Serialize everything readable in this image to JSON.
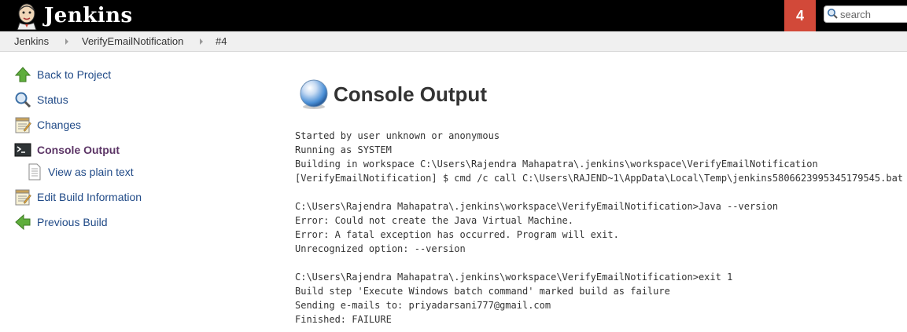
{
  "header": {
    "brand": "Jenkins",
    "notification_count": "4",
    "search_placeholder": "search"
  },
  "breadcrumbs": [
    "Jenkins",
    "VerifyEmailNotification",
    "#4"
  ],
  "sidebar": {
    "items": [
      {
        "label": "Back to Project",
        "icon": "up-arrow-icon"
      },
      {
        "label": "Status",
        "icon": "magnifier-icon"
      },
      {
        "label": "Changes",
        "icon": "notepad-icon"
      },
      {
        "label": "Console Output",
        "icon": "terminal-icon",
        "active": true
      },
      {
        "label": "View as plain text",
        "icon": "document-icon"
      },
      {
        "label": "Edit Build Information",
        "icon": "notepad-edit-icon"
      },
      {
        "label": "Previous Build",
        "icon": "left-arrow-icon"
      }
    ]
  },
  "main": {
    "title": "Console Output",
    "status_color": "#4a8fd6",
    "console_lines": [
      "Started by user unknown or anonymous",
      "Running as SYSTEM",
      "Building in workspace C:\\Users\\Rajendra Mahapatra\\.jenkins\\workspace\\VerifyEmailNotification",
      "[VerifyEmailNotification] $ cmd /c call C:\\Users\\RAJEND~1\\AppData\\Local\\Temp\\jenkins5806623995345179545.bat",
      "",
      "C:\\Users\\Rajendra Mahapatra\\.jenkins\\workspace\\VerifyEmailNotification>Java --version",
      "Error: Could not create the Java Virtual Machine.",
      "Error: A fatal exception has occurred. Program will exit.",
      "Unrecognized option: --version",
      "",
      "C:\\Users\\Rajendra Mahapatra\\.jenkins\\workspace\\VerifyEmailNotification>exit 1",
      "Build step 'Execute Windows batch command' marked build as failure",
      "Sending e-mails to: priyadarsani777@gmail.com",
      "Finished: FAILURE"
    ]
  }
}
